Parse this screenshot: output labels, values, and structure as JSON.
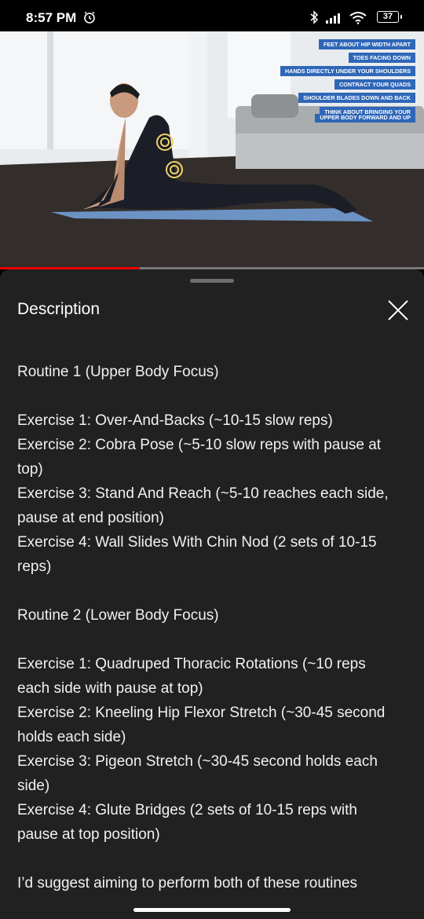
{
  "status_bar": {
    "time": "8:57 PM",
    "battery": "37",
    "icons": [
      "alarm-icon",
      "bluetooth-icon",
      "signal-icon",
      "wifi-icon",
      "battery-icon"
    ]
  },
  "video": {
    "overlay_tips": [
      "FEET ABOUT HIP WIDTH APART",
      "TOES FACING DOWN",
      "HANDS DIRECTLY UNDER YOUR SHOULDERS",
      "CONTRACT YOUR QUADS",
      "SHOULDER BLADES DOWN AND BACK",
      "THINK ABOUT BRINGING YOUR",
      "UPPER BODY FORWARD AND UP"
    ],
    "progress": 0.33
  },
  "sheet": {
    "title": "Description",
    "close_icon": "close-icon",
    "description": "Routine 1 (Upper Body Focus)\n\nExercise 1: Over-And-Backs (~10-15 slow reps)\nExercise 2: Cobra Pose (~5-10 slow reps with pause at top)\nExercise 3: Stand And Reach (~5-10 reaches each side, pause at end position)\nExercise 4: Wall Slides With Chin Nod (2 sets of 10-15 reps)\n\nRoutine 2 (Lower Body Focus)\n\nExercise 1: Quadruped Thoracic Rotations (~10 reps each side with pause at top)\nExercise 2: Kneeling Hip Flexor Stretch (~30-45 second holds each side)\nExercise 3: Pigeon Stretch (~30-45 second holds each side)\nExercise 4: Glute Bridges (2 sets of 10-15 reps with pause at top position)\n\nI’d suggest aiming to perform both of these routines"
  }
}
